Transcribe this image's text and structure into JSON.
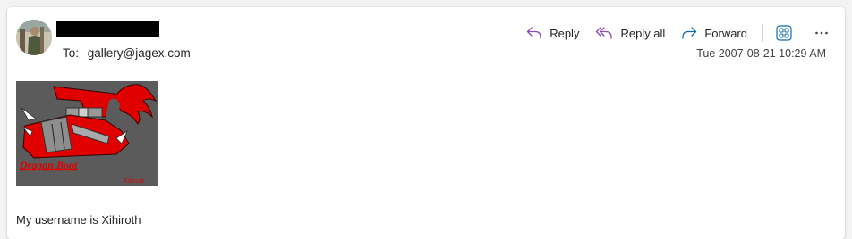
{
  "message": {
    "to_label": "To:",
    "to_address": "gallery@jagex.com",
    "date": "Tue 2007-08-21 10:29 AM",
    "body": "My username is Xihiroth"
  },
  "actions": {
    "reply": "Reply",
    "reply_all": "Reply all",
    "forward": "Forward"
  },
  "image": {
    "caption": "Dragon Boot",
    "signature": "Xihiroth"
  },
  "colors": {
    "accent_purple": "#8a4bb8",
    "accent_blue": "#0f6cbd",
    "boot_red": "#e00000",
    "image_bg": "#5b5b5b"
  },
  "icons": {
    "reply": "reply-icon",
    "reply_all": "reply-all-icon",
    "forward": "forward-icon",
    "apps": "apps-icon",
    "more": "more-icon"
  }
}
